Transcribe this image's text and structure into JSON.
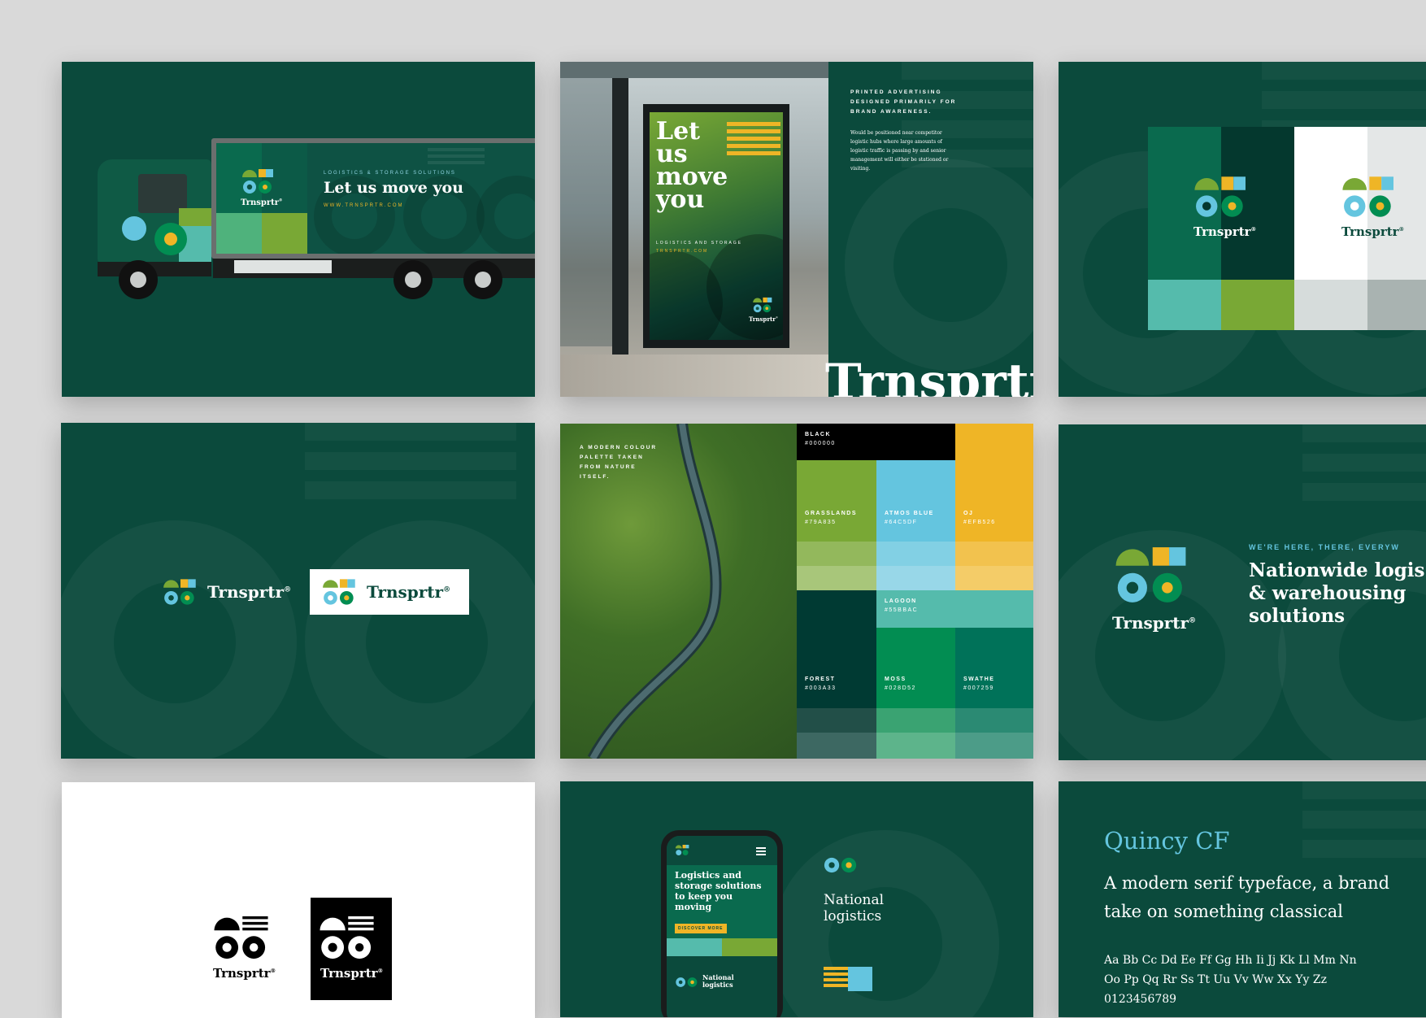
{
  "brand": {
    "wordmark": "Trnsprtr",
    "reg": "®"
  },
  "truck": {
    "tagline_small": "LOGISTICS & STORAGE SOLUTIONS",
    "headline": "Let us move you",
    "url": "WWW.TRNSPRTR.COM"
  },
  "billboard": {
    "poster_headline": [
      "Let",
      "us",
      "move",
      "you"
    ],
    "poster_small": "LOGISTICS AND STORAGE",
    "poster_url": "TRNSPRTR.COM",
    "heading": "PRINTED ADVERTISING DESIGNED PRIMARILY FOR BRAND AWARENESS.",
    "body": "Would be positioned near competitor logistic hubs where large amounts of logistic traffic is passing by and senior management will either be stationed or visiting.",
    "big_wordmark": "Trnsprtr"
  },
  "palette": {
    "intro": "A MODERN COLOUR PALETTE TAKEN FROM NATURE ITSELF.",
    "swatches": [
      {
        "name": "BLACK",
        "hex": "#000000",
        "color": "#000000"
      },
      {
        "name": "GRASSLANDS",
        "hex": "#79A835",
        "color": "#79a835"
      },
      {
        "name": "ATMOS BLUE",
        "hex": "#64C5DF",
        "color": "#64c5df"
      },
      {
        "name": "OJ",
        "hex": "#EFB526",
        "color": "#efb526"
      },
      {
        "name": "LAGOON",
        "hex": "#55BBAC",
        "color": "#55bbac"
      },
      {
        "name": "FOREST",
        "hex": "#003A33",
        "color": "#003a33"
      },
      {
        "name": "MOSS",
        "hex": "#028D52",
        "color": "#028d52"
      },
      {
        "name": "SWATHE",
        "hex": "#007259",
        "color": "#007259"
      }
    ]
  },
  "nationwide": {
    "eyebrow": "WE'RE HERE, THERE, EVERYW",
    "headline_lines": [
      "Nationwide logis",
      "& warehousing",
      "solutions"
    ]
  },
  "mobile": {
    "hero_text": "Logistics and storage solutions to keep you moving",
    "cta": "DISCOVER MORE",
    "section_title": "National logistics",
    "side_title": "National logistics"
  },
  "typeface": {
    "name": "Quincy CF",
    "description_lines": [
      "A modern serif typeface, a brand",
      "take on something classical"
    ],
    "alphabet_1": "Aa Bb Cc Dd Ee Ff Gg Hh Ii Jj Kk Ll Mm Nn",
    "alphabet_2": "Oo Pp Qq Rr Ss Tt Uu Vv Ww Xx Yy Zz",
    "digits": "0123456789"
  },
  "colors": {
    "forest": "#0b4a3c",
    "grass": "#79a835",
    "atmos": "#64c5df",
    "oj": "#efb526",
    "lagoon": "#55bbac",
    "moss": "#028d52",
    "swathe": "#007259"
  }
}
